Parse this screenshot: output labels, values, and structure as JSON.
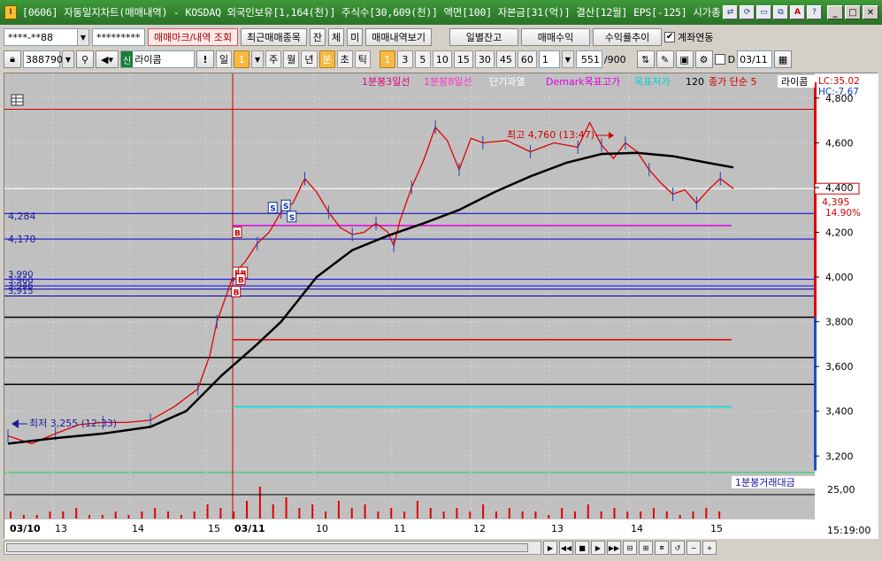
{
  "window": {
    "title": "[0606] 자동일지차트(매매내역) - KOSDAQ 외국인보유[1,164(천)] 주식수[30,609(천)] 액면[100] 자본금[31(억)] 결산[12월] EPS[-125] 시가총",
    "app_icon": "I"
  },
  "toolbar1": {
    "account": "****-**88",
    "password": "*********",
    "buttons": [
      "매매마크/내역 조회",
      "최근매매종목",
      "잔",
      "체",
      "미",
      "매매내역보기"
    ],
    "right_buttons": [
      "일별잔고",
      "매매수익",
      "수익률추이"
    ],
    "check_label": "계좌연동",
    "check_on": true
  },
  "toolbar2": {
    "code": "388790",
    "market_tag": "신",
    "stock_name": "라이콤",
    "period_day": "일",
    "period_num": "1",
    "periods": [
      "주",
      "월",
      "년",
      "분",
      "초",
      "틱"
    ],
    "minute_opts": [
      "1",
      "3",
      "5",
      "10",
      "15",
      "30",
      "45",
      "60"
    ],
    "interval_value": "1",
    "count": "551",
    "count_total": "/900",
    "date_check": "D",
    "date": "03/11"
  },
  "legend": {
    "ma3": "1분봉3일선",
    "ma8": "1분봉8일선",
    "overheat": "단기과열",
    "demark_high": "Demark목표고가",
    "demark_low": "목표저가",
    "period": "120",
    "close_label": "종가 단순 5",
    "name": "라이콤",
    "lc": "LC:35.02",
    "hc": "HC:-7.67",
    "volume_legend": "1분봉거래대금"
  },
  "colors": {
    "ma3": "#e0007a",
    "ma8": "#ff33cc",
    "demark_high": "#e000e0",
    "demark_low": "#00c0c0",
    "price": "#e00000",
    "ma": "#000000",
    "blue_line": "#0000d0",
    "bg": "#c0c0c0"
  },
  "price_labels": {
    "hline_4284": "4,284",
    "hline_4170": "4,170",
    "hline_3990": "3,990",
    "hline_3960": "3,960",
    "hline_3946": "3,946",
    "hline_3915": "3,915",
    "high_note": "최고 4,760 (13:47)",
    "low_note": "최저 3,255 (12:33)",
    "current_price": "4,395",
    "current_change": "14.90%"
  },
  "chart_data": {
    "type": "line",
    "y_ticks": [
      "4,800",
      "4,600",
      "4,400",
      "4,200",
      "4,000",
      "3,800",
      "3,600",
      "3,400",
      "3,200"
    ],
    "ylim": [
      3130,
      4910
    ],
    "x_labels": [
      "03/10",
      "13",
      "14",
      "15",
      "03/11",
      "10",
      "11",
      "12",
      "13",
      "14",
      "15"
    ],
    "volume_tick": "25,00",
    "time": "15:19:00",
    "price_series": [
      [
        0,
        3290
      ],
      [
        20,
        3255
      ],
      [
        40,
        3300
      ],
      [
        60,
        3340
      ],
      [
        80,
        3350
      ],
      [
        100,
        3350
      ],
      [
        120,
        3360
      ],
      [
        140,
        3420
      ],
      [
        160,
        3500
      ],
      [
        170,
        3650
      ],
      [
        176,
        3800
      ],
      [
        180,
        3860
      ],
      [
        190,
        4010
      ],
      [
        200,
        4070
      ],
      [
        210,
        4150
      ],
      [
        220,
        4200
      ],
      [
        230,
        4290
      ],
      [
        240,
        4330
      ],
      [
        250,
        4440
      ],
      [
        260,
        4380
      ],
      [
        270,
        4290
      ],
      [
        280,
        4220
      ],
      [
        290,
        4190
      ],
      [
        300,
        4200
      ],
      [
        310,
        4240
      ],
      [
        320,
        4200
      ],
      [
        325,
        4140
      ],
      [
        330,
        4250
      ],
      [
        340,
        4400
      ],
      [
        350,
        4520
      ],
      [
        360,
        4670
      ],
      [
        370,
        4610
      ],
      [
        380,
        4480
      ],
      [
        390,
        4620
      ],
      [
        400,
        4600
      ],
      [
        420,
        4610
      ],
      [
        440,
        4560
      ],
      [
        460,
        4600
      ],
      [
        480,
        4580
      ],
      [
        490,
        4690
      ],
      [
        500,
        4590
      ],
      [
        510,
        4530
      ],
      [
        520,
        4600
      ],
      [
        530,
        4560
      ],
      [
        540,
        4480
      ],
      [
        550,
        4420
      ],
      [
        560,
        4370
      ],
      [
        570,
        4390
      ],
      [
        580,
        4330
      ],
      [
        590,
        4390
      ],
      [
        600,
        4440
      ],
      [
        611,
        4395
      ]
    ],
    "ma_series": [
      [
        0,
        3255
      ],
      [
        40,
        3280
      ],
      [
        80,
        3300
      ],
      [
        120,
        3330
      ],
      [
        150,
        3400
      ],
      [
        180,
        3560
      ],
      [
        210,
        3700
      ],
      [
        230,
        3800
      ],
      [
        260,
        4000
      ],
      [
        290,
        4120
      ],
      [
        320,
        4185
      ],
      [
        350,
        4240
      ],
      [
        380,
        4300
      ],
      [
        410,
        4380
      ],
      [
        440,
        4450
      ],
      [
        470,
        4510
      ],
      [
        500,
        4550
      ],
      [
        530,
        4555
      ],
      [
        560,
        4540
      ],
      [
        590,
        4510
      ],
      [
        611,
        4490
      ]
    ],
    "hlines": [
      {
        "value": 4284,
        "color": "#0000d0"
      },
      {
        "value": 4170,
        "color": "#0000d0"
      },
      {
        "value": 3990,
        "color": "#0000ff"
      },
      {
        "value": 3960,
        "color": "#0000ff"
      },
      {
        "value": 3946,
        "color": "#0000aa"
      },
      {
        "value": 3915,
        "color": "#0000aa"
      },
      {
        "value": 3820,
        "color": "#000000"
      },
      {
        "value": 3640,
        "color": "#000000"
      },
      {
        "value": 3520,
        "color": "#000000"
      }
    ],
    "demark_high": 4230,
    "demark_low": 3420,
    "red_level": 3720,
    "top_red": 4750,
    "volume": [
      2,
      1,
      1,
      2,
      2,
      3,
      1,
      1,
      2,
      1,
      2,
      3,
      2,
      1,
      2,
      4,
      3,
      2,
      5,
      9,
      4,
      6,
      3,
      4,
      2,
      5,
      3,
      4,
      2,
      3,
      2,
      5,
      3,
      2,
      3,
      2,
      4,
      2,
      3,
      2,
      2,
      1,
      3,
      2,
      4,
      2,
      3,
      2,
      2,
      3,
      2,
      1,
      2,
      3,
      2
    ]
  }
}
